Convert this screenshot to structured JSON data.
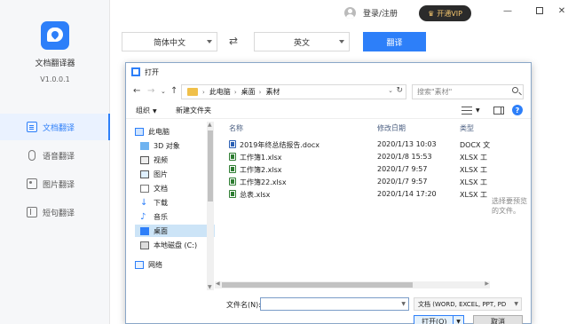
{
  "app": {
    "name": "文档翻译器",
    "version": "V1.0.0.1",
    "nav": [
      {
        "label": "文档翻译",
        "icon": "document-icon",
        "active": true
      },
      {
        "label": "语音翻译",
        "icon": "microphone-icon",
        "active": false
      },
      {
        "label": "图片翻译",
        "icon": "image-icon",
        "active": false
      },
      {
        "label": "短句翻译",
        "icon": "short-text-icon",
        "active": false
      }
    ]
  },
  "topbar": {
    "login": "登录/注册",
    "vip": "开通VIP",
    "window_controls": [
      "minimize-icon",
      "maximize-icon",
      "close-icon"
    ]
  },
  "translate_bar": {
    "source_lang": "简体中文",
    "target_lang": "英文",
    "translate_button": "翻译"
  },
  "dialog": {
    "title": "打开",
    "breadcrumbs": [
      "此电脑",
      "桌面",
      "素材"
    ],
    "search_placeholder": "搜索\"素材\"",
    "toolbar": {
      "organize": "组织",
      "new_folder": "新建文件夹"
    },
    "tree": [
      {
        "label": "此电脑",
        "icon": "computer-icon"
      },
      {
        "label": "3D 对象",
        "icon": "3d-objects-icon"
      },
      {
        "label": "视频",
        "icon": "video-icon"
      },
      {
        "label": "图片",
        "icon": "pictures-icon"
      },
      {
        "label": "文档",
        "icon": "documents-icon"
      },
      {
        "label": "下载",
        "icon": "download-icon"
      },
      {
        "label": "音乐",
        "icon": "music-icon"
      },
      {
        "label": "桌面",
        "icon": "desktop-icon",
        "selected": true
      },
      {
        "label": "本地磁盘 (C:)",
        "icon": "drive-icon"
      },
      {
        "label": "网络",
        "icon": "network-icon"
      }
    ],
    "columns": {
      "name": "名称",
      "modified": "修改日期",
      "type": "类型"
    },
    "files": [
      {
        "name": "2019年终总结报告.docx",
        "modified": "2020/1/13 10:03",
        "type": "DOCX 文",
        "kind": "docx"
      },
      {
        "name": "工作簿1.xlsx",
        "modified": "2020/1/8 15:53",
        "type": "XLSX 工",
        "kind": "xlsx"
      },
      {
        "name": "工作簿2.xlsx",
        "modified": "2020/1/7 9:57",
        "type": "XLSX 工",
        "kind": "xlsx"
      },
      {
        "name": "工作簿22.xlsx",
        "modified": "2020/1/7 9:57",
        "type": "XLSX 工",
        "kind": "xlsx"
      },
      {
        "name": "总表.xlsx",
        "modified": "2020/1/14 17:20",
        "type": "XLSX 工",
        "kind": "xlsx"
      }
    ],
    "preview_hint": "选择要预览的文件。",
    "filename_label": "文件名(N):",
    "filename_value": "",
    "filetype": "文档 (WORD, EXCEL, PPT, PD",
    "open_button": "打开(O)",
    "cancel_button": "取消"
  },
  "colors": {
    "accent": "#2d7ff9",
    "vip_bg": "#2b2b2b",
    "vip_text": "#f2c46d"
  }
}
